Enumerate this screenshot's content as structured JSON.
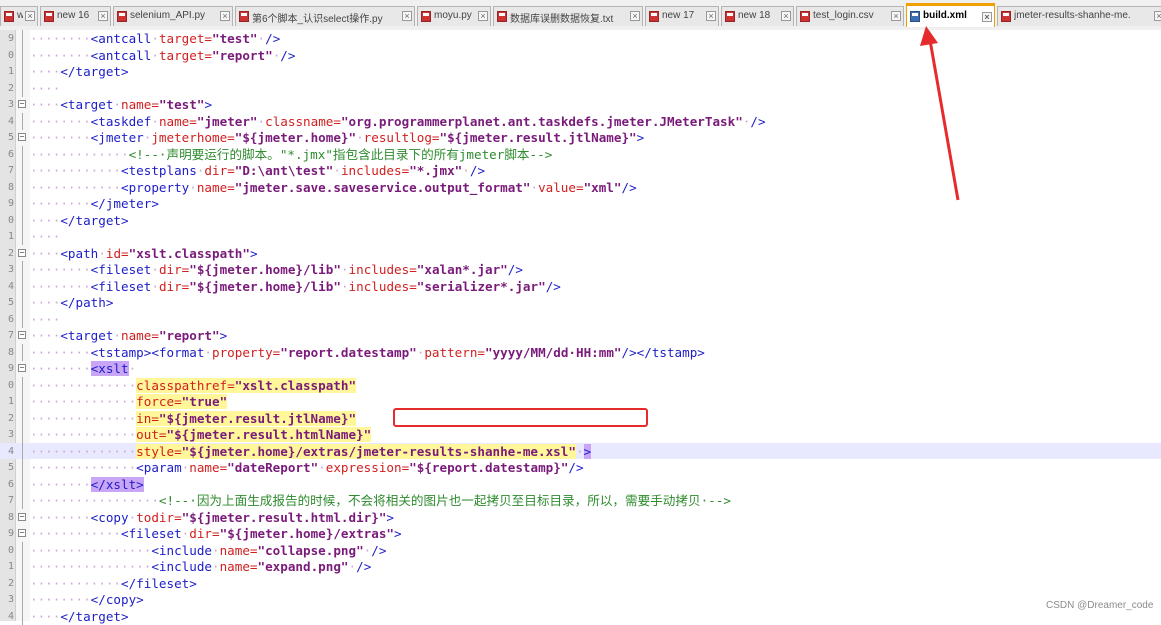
{
  "tabs": [
    {
      "label": "w 15"
    },
    {
      "label": "new 16"
    },
    {
      "label": "selenium_API.py"
    },
    {
      "label": "第6个脚本_认识select操作.py"
    },
    {
      "label": "moyu.py"
    },
    {
      "label": "数据库误删数据恢复.txt"
    },
    {
      "label": "new 17"
    },
    {
      "label": "new 18"
    },
    {
      "label": "test_login.csv"
    },
    {
      "label": "build.xml",
      "active": true
    },
    {
      "label": "jmeter-results-shanhe-me."
    }
  ],
  "line_numbers": [
    "9",
    "0",
    "1",
    "2",
    "3",
    "4",
    "5",
    "6",
    "7",
    "8",
    "9",
    "0",
    "1",
    "2",
    "3",
    "4",
    "5",
    "6",
    "7",
    "8",
    "9",
    "0",
    "1",
    "2",
    "3",
    "4",
    "5",
    "6",
    "7",
    "8",
    "9",
    "0",
    "1",
    "2",
    "3",
    "4",
    "5"
  ],
  "code_lines": [
    [
      [
        "dots",
        "········"
      ],
      [
        "tag",
        "<antcall"
      ],
      [
        "dots",
        "·"
      ],
      [
        "attr",
        "target="
      ],
      [
        "val",
        "\"test\""
      ],
      [
        "dots",
        "·"
      ],
      [
        "tag",
        "/>"
      ]
    ],
    [
      [
        "dots",
        "········"
      ],
      [
        "tag",
        "<antcall"
      ],
      [
        "dots",
        "·"
      ],
      [
        "attr",
        "target="
      ],
      [
        "val",
        "\"report\""
      ],
      [
        "dots",
        "·"
      ],
      [
        "tag",
        "/>"
      ]
    ],
    [
      [
        "dots",
        "····"
      ],
      [
        "tag",
        "</target>"
      ]
    ],
    [
      [
        "dots",
        "····"
      ]
    ],
    [
      [
        "dots",
        "····"
      ],
      [
        "tag",
        "<target"
      ],
      [
        "dots",
        "·"
      ],
      [
        "attr",
        "name="
      ],
      [
        "val",
        "\"test\""
      ],
      [
        "tag",
        ">"
      ]
    ],
    [
      [
        "dots",
        "········"
      ],
      [
        "tag",
        "<taskdef"
      ],
      [
        "dots",
        "·"
      ],
      [
        "attr",
        "name="
      ],
      [
        "val",
        "\"jmeter\""
      ],
      [
        "dots",
        "·"
      ],
      [
        "attr",
        "classname="
      ],
      [
        "val",
        "\"org.programmerplanet.ant.taskdefs.jmeter.JMeterTask\""
      ],
      [
        "dots",
        "·"
      ],
      [
        "tag",
        "/>"
      ]
    ],
    [
      [
        "dots",
        "········"
      ],
      [
        "tag",
        "<jmeter"
      ],
      [
        "dots",
        "·"
      ],
      [
        "attr",
        "jmeterhome="
      ],
      [
        "val",
        "\"${jmeter.home}\""
      ],
      [
        "dots",
        "·"
      ],
      [
        "attr",
        "resultlog="
      ],
      [
        "val",
        "\"${jmeter.result.jtlName}\""
      ],
      [
        "tag",
        ">"
      ]
    ],
    [
      [
        "dots",
        "·············"
      ],
      [
        "cmt",
        "<!--·声明要运行的脚本。\"*.jmx\"指包含此目录下的所有jmeter脚本-->"
      ]
    ],
    [
      [
        "dots",
        "············"
      ],
      [
        "tag",
        "<testplans"
      ],
      [
        "dots",
        "·"
      ],
      [
        "attr",
        "dir="
      ],
      [
        "val",
        "\"D:\\ant\\test\""
      ],
      [
        "dots",
        "·"
      ],
      [
        "attr",
        "includes="
      ],
      [
        "val",
        "\"*.jmx\""
      ],
      [
        "dots",
        "·"
      ],
      [
        "tag",
        "/>"
      ]
    ],
    [
      [
        "dots",
        "············"
      ],
      [
        "tag",
        "<property"
      ],
      [
        "dots",
        "·"
      ],
      [
        "attr",
        "name="
      ],
      [
        "val",
        "\"jmeter.save.saveservice.output_format\""
      ],
      [
        "dots",
        "·"
      ],
      [
        "attr",
        "value="
      ],
      [
        "val",
        "\"xml\""
      ],
      [
        "tag",
        "/>"
      ]
    ],
    [
      [
        "dots",
        "········"
      ],
      [
        "tag",
        "</jmeter>"
      ]
    ],
    [
      [
        "dots",
        "····"
      ],
      [
        "tag",
        "</target>"
      ]
    ],
    [
      [
        "dots",
        "····"
      ]
    ],
    [
      [
        "dots",
        "····"
      ],
      [
        "tag",
        "<path"
      ],
      [
        "dots",
        "·"
      ],
      [
        "attr",
        "id="
      ],
      [
        "val",
        "\"xslt.classpath\""
      ],
      [
        "tag",
        ">"
      ]
    ],
    [
      [
        "dots",
        "········"
      ],
      [
        "tag",
        "<fileset"
      ],
      [
        "dots",
        "·"
      ],
      [
        "attr",
        "dir="
      ],
      [
        "val",
        "\"${jmeter.home}/lib\""
      ],
      [
        "dots",
        "·"
      ],
      [
        "attr",
        "includes="
      ],
      [
        "val",
        "\"xalan*.jar\""
      ],
      [
        "tag",
        "/>"
      ]
    ],
    [
      [
        "dots",
        "········"
      ],
      [
        "tag",
        "<fileset"
      ],
      [
        "dots",
        "·"
      ],
      [
        "attr",
        "dir="
      ],
      [
        "val",
        "\"${jmeter.home}/lib\""
      ],
      [
        "dots",
        "·"
      ],
      [
        "attr",
        "includes="
      ],
      [
        "val",
        "\"serializer*.jar\""
      ],
      [
        "tag",
        "/>"
      ]
    ],
    [
      [
        "dots",
        "····"
      ],
      [
        "tag",
        "</path>"
      ]
    ],
    [
      [
        "dots",
        "····"
      ]
    ],
    [
      [
        "dots",
        "····"
      ],
      [
        "tag",
        "<target"
      ],
      [
        "dots",
        "·"
      ],
      [
        "attr",
        "name="
      ],
      [
        "val",
        "\"report\""
      ],
      [
        "tag",
        ">"
      ]
    ],
    [
      [
        "dots",
        "········"
      ],
      [
        "tag",
        "<tstamp><format"
      ],
      [
        "dots",
        "·"
      ],
      [
        "attr",
        "property="
      ],
      [
        "val",
        "\"report.datestamp\""
      ],
      [
        "dots",
        "·"
      ],
      [
        "attr",
        "pattern="
      ],
      [
        "val",
        "\"yyyy/MM/dd·HH:mm\""
      ],
      [
        "tag",
        "/></tstamp>"
      ]
    ],
    [
      [
        "dots",
        "········"
      ],
      [
        "tag hl-p",
        "<xslt"
      ],
      [
        "dots",
        "·"
      ]
    ],
    [
      [
        "dots",
        "··············"
      ],
      [
        "attr hl-y",
        "classpathref="
      ],
      [
        "val hl-y",
        "\"xslt.classpath\""
      ]
    ],
    [
      [
        "dots",
        "··············"
      ],
      [
        "attr hl-y",
        "force="
      ],
      [
        "val hl-y",
        "\"true\""
      ]
    ],
    [
      [
        "dots",
        "··············"
      ],
      [
        "attr hl-y",
        "in="
      ],
      [
        "val hl-y",
        "\"${jmeter.result.jtlName}\""
      ]
    ],
    [
      [
        "dots",
        "··············"
      ],
      [
        "attr hl-y",
        "out="
      ],
      [
        "val hl-y",
        "\"${jmeter.result.htmlName}\""
      ]
    ],
    [
      [
        "dots",
        "··············"
      ],
      [
        "attr hl-y",
        "style="
      ],
      [
        "val hl-y",
        "\"${jmeter.home}/extras/jmeter-results-shanhe-me.xsl\""
      ],
      [
        "dots",
        "·"
      ],
      [
        "tag hl-p",
        ">"
      ]
    ],
    [
      [
        "dots",
        "··············"
      ],
      [
        "tag",
        "<param"
      ],
      [
        "dots",
        "·"
      ],
      [
        "attr",
        "name="
      ],
      [
        "val",
        "\"dateReport\""
      ],
      [
        "dots",
        "·"
      ],
      [
        "attr",
        "expression="
      ],
      [
        "val",
        "\"${report.datestamp}\""
      ],
      [
        "tag",
        "/>"
      ]
    ],
    [
      [
        "dots",
        "········"
      ],
      [
        "tag hl-p",
        "</xslt>"
      ]
    ],
    [
      [
        "dots",
        "·················"
      ],
      [
        "cmt",
        "<!--·因为上面生成报告的时候，不会将相关的图片也一起拷贝至目标目录，所以，需要手动拷贝·-->"
      ]
    ],
    [
      [
        "dots",
        "········"
      ],
      [
        "tag",
        "<copy"
      ],
      [
        "dots",
        "·"
      ],
      [
        "attr",
        "todir="
      ],
      [
        "val",
        "\"${jmeter.result.html.dir}\""
      ],
      [
        "tag",
        ">"
      ]
    ],
    [
      [
        "dots",
        "············"
      ],
      [
        "tag",
        "<fileset"
      ],
      [
        "dots",
        "·"
      ],
      [
        "attr",
        "dir="
      ],
      [
        "val",
        "\"${jmeter.home}/extras\""
      ],
      [
        "tag",
        ">"
      ]
    ],
    [
      [
        "dots",
        "················"
      ],
      [
        "tag",
        "<include"
      ],
      [
        "dots",
        "·"
      ],
      [
        "attr",
        "name="
      ],
      [
        "val",
        "\"collapse.png\""
      ],
      [
        "dots",
        "·"
      ],
      [
        "tag",
        "/>"
      ]
    ],
    [
      [
        "dots",
        "················"
      ],
      [
        "tag",
        "<include"
      ],
      [
        "dots",
        "·"
      ],
      [
        "attr",
        "name="
      ],
      [
        "val",
        "\"expand.png\""
      ],
      [
        "dots",
        "·"
      ],
      [
        "tag",
        "/>"
      ]
    ],
    [
      [
        "dots",
        "············"
      ],
      [
        "tag",
        "</fileset>"
      ]
    ],
    [
      [
        "dots",
        "········"
      ],
      [
        "tag",
        "</copy>"
      ]
    ],
    [
      [
        "dots",
        "····"
      ],
      [
        "tag",
        "</target>"
      ]
    ]
  ],
  "fold_markers": {
    "4": "minus",
    "6": "minus",
    "13": "minus",
    "18": "minus",
    "20": "minus",
    "29": "minus",
    "30": "minus"
  },
  "current_line": 25,
  "watermark": "CSDN @Dreamer_code",
  "colors": {
    "active_tab_accent": "#f0a000",
    "annotation_red": "#e52b2b",
    "highlight_yellow": "#fff79a",
    "highlight_purple": "#c9a6f5"
  }
}
